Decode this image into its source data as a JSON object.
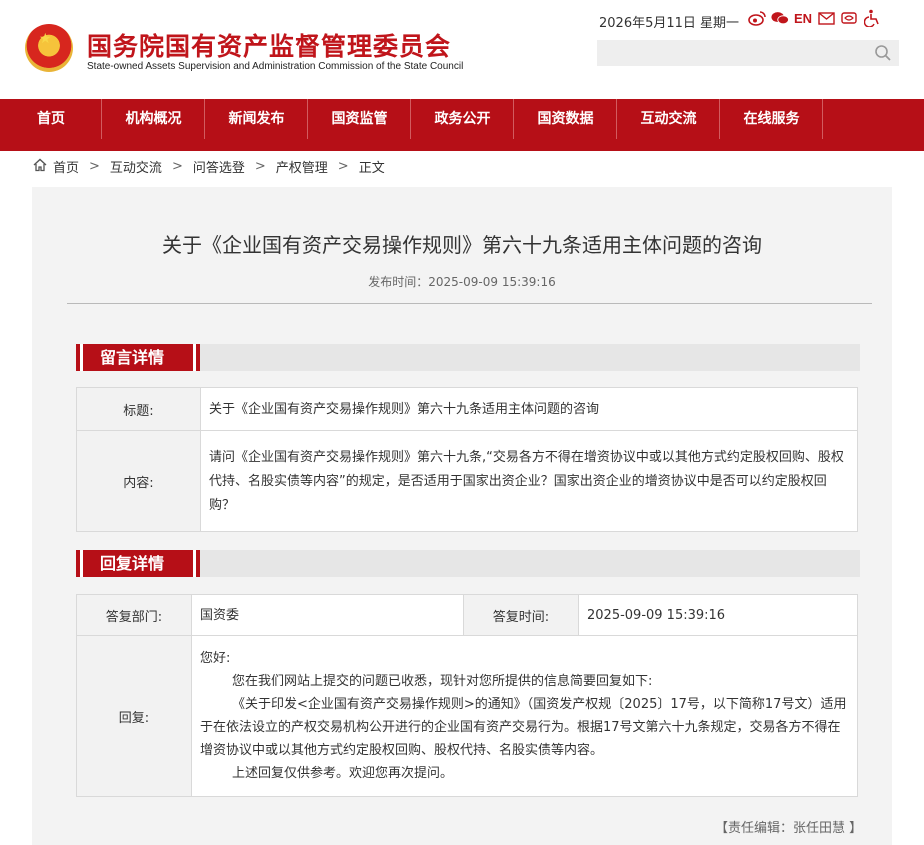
{
  "header": {
    "title": "国务院国有资产监督管理委员会",
    "subtitle": "State-owned Assets Supervision and Administration Commission of the State Council",
    "date": "2026年5月11日 星期一",
    "en_label": "EN",
    "search_placeholder": ""
  },
  "icons": [
    "weibo-icon",
    "wechat-icon",
    "email-icon",
    "eye-care-icon",
    "accessibility-icon",
    "search-icon",
    "home-icon"
  ],
  "nav": {
    "items": [
      "首页",
      "机构概况",
      "新闻发布",
      "国资监管",
      "政务公开",
      "国资数据",
      "互动交流",
      "在线服务"
    ]
  },
  "breadcrumb": [
    "首页",
    "互动交流",
    "问答选登",
    "产权管理",
    "正文"
  ],
  "breadcrumb_sep": ">",
  "article": {
    "title": "关于《企业国有资产交易操作规则》第六十九条适用主体问题的咨询",
    "publish_time": "发布时间：2025-09-09 15:39:16"
  },
  "message": {
    "section_label": "留言详情",
    "title_label": "标题:",
    "title_value": "关于《企业国有资产交易操作规则》第六十九条适用主体问题的咨询",
    "content_label": "内容:",
    "content_value": "请问《企业国有资产交易操作规则》第六十九条,“交易各方不得在增资协议中或以其他方式约定股权回购、股权代持、名股实债等内容”的规定，是否适用于国家出资企业？国家出资企业的增资协议中是否可以约定股权回购？"
  },
  "reply": {
    "section_label": "回复详情",
    "dept_label": "答复部门:",
    "dept_value": "国资委",
    "time_label": "答复时间:",
    "time_value": "2025-09-09 15:39:16",
    "reply_label": "回复:",
    "greeting": "您好:",
    "line1": "您在我们网站上提交的问题已收悉，现针对您所提供的信息简要回复如下:",
    "line2": "《关于印发<企业国有资产交易操作规则>的通知》（国资发产权规〔2025〕17号，以下简称17号文）适用于在依法设立的产权交易机构公开进行的企业国有资产交易行为。根据17号文第六十九条规定，交易各方不得在增资协议中或以其他方式约定股权回购、股权代持、名股实债等内容。",
    "line3": "上述回复仅供参考。欢迎您再次提问。"
  },
  "editor": "【责任编辑：张任田慧 】",
  "colors": {
    "brand_red": "#b60f17",
    "panel_bg": "#f3f3f3"
  }
}
